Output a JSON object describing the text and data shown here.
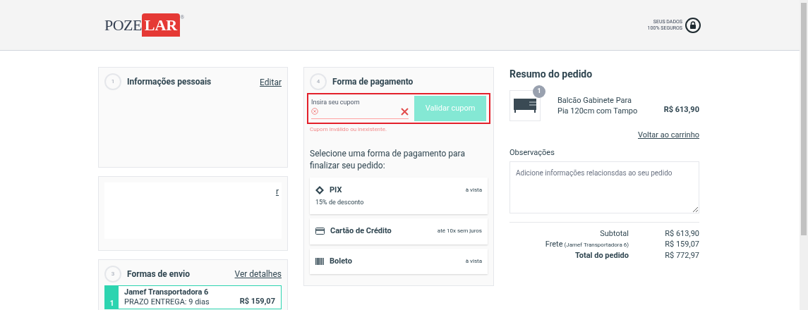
{
  "header": {
    "logo": {
      "part_1": "POZE",
      "part_2": "LAR",
      "mark": "®"
    },
    "security": {
      "line_1": "SEUS DADOS",
      "line_2": "100% SEGUROS"
    }
  },
  "personal_info": {
    "step": "1",
    "title": "Informações pessoais",
    "link": "Editar"
  },
  "address": {
    "link": "r"
  },
  "shipping": {
    "step": "3",
    "title": "Formas de envio",
    "link": "Ver detalhes",
    "options": [
      {
        "number": "1",
        "name": "Jamef Transportadora 6",
        "deadline": "PRAZO ENTREGA: 9 dias",
        "price": "R$ 159,07",
        "selected": true
      }
    ]
  },
  "payment": {
    "step": "4",
    "title": "Forma de pagamento",
    "coupon": {
      "label": "Insira seu cupom",
      "button": "Validar cupom",
      "error": "Cupom inválido ou inexistente.",
      "invalid": true,
      "highlighted": true
    },
    "instruction": "Selecione uma forma de pagamento para finalizar seu pedido:",
    "methods": [
      {
        "kind": "pix",
        "name": "PIX",
        "note": "15% de desconto",
        "terms": "à vista"
      },
      {
        "kind": "card",
        "name": "Cartão de Crédito",
        "terms": "até 10x sem juros"
      },
      {
        "kind": "boleto",
        "name": "Boleto",
        "terms": "à vista"
      }
    ]
  },
  "summary": {
    "title": "Resumo do pedido",
    "items": [
      {
        "quantity": "1",
        "name": "Balcão Gabinete Para Pia 120cm com Tampo",
        "price": "R$ 613,90"
      }
    ],
    "back_link": "Voltar ao carrinho",
    "notes_label": "Observações",
    "notes_placeholder": "Adicione informações relacionsdas ao seu pedido",
    "totals": [
      {
        "kind": "plain",
        "label": "Subtotal",
        "value": "R$ 613,90"
      },
      {
        "kind": "shipping",
        "label": "Frete",
        "detail": "(Jamef Transportadora 6)",
        "value": "R$ 159,07"
      },
      {
        "kind": "total",
        "label": "Total do pedido",
        "value": "R$ 772,97"
      }
    ]
  }
}
